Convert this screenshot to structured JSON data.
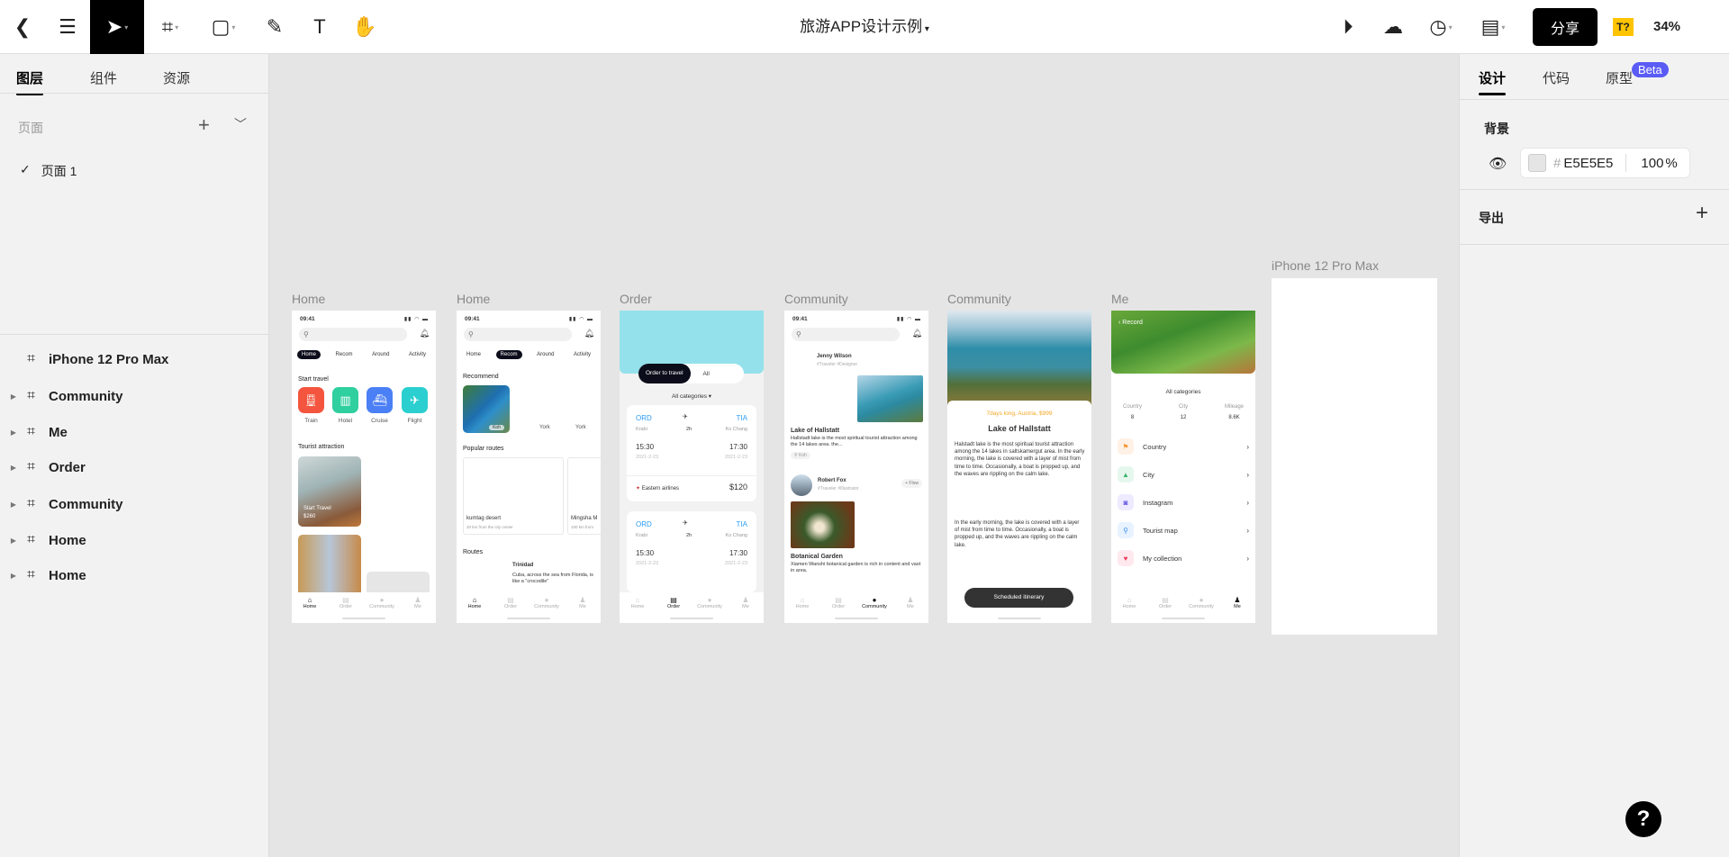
{
  "toolbar": {
    "title": "旅游APP设计示例",
    "share": "分享",
    "zoom": "34%",
    "font_badge": "T?",
    "icons": [
      "back-icon",
      "menu-icon",
      "move-tool-icon",
      "frame-tool-icon",
      "rectangle-tool-icon",
      "pen-tool-icon",
      "text-tool-icon",
      "hand-tool-icon",
      "play-icon",
      "upload-icon",
      "history-icon",
      "layout-icon"
    ]
  },
  "left": {
    "tabs": [
      "图层",
      "组件",
      "资源"
    ],
    "pages_label": "页面",
    "pages": [
      {
        "name": "页面 1",
        "selected": true
      }
    ],
    "layers": [
      "iPhone 12 Pro Max",
      "Community",
      "Me",
      "Order",
      "Community",
      "Home",
      "Home"
    ]
  },
  "right": {
    "tabs": [
      "设计",
      "代码",
      "原型"
    ],
    "beta": "Beta",
    "background_label": "背景",
    "bg_hash": "#",
    "bg_color": "E5E5E5",
    "bg_opacity": "100",
    "pct": "%",
    "export_label": "导出"
  },
  "colors": {
    "accent": "#5b5bf6",
    "canvas": "#E5E5E5",
    "order_header": "#94e1ec"
  },
  "frames": {
    "labels": [
      "Home",
      "Home",
      "Order",
      "Community",
      "Community",
      "Me",
      "iPhone 12 Pro Max"
    ],
    "time": "09:41",
    "tabs": [
      "Home",
      "Recom",
      "Around",
      "Activity"
    ],
    "nav": [
      "Home",
      "Order",
      "Community",
      "Me"
    ],
    "home": {
      "start_travel": "Start travel",
      "services": [
        "Train",
        "Hotel",
        "Cruise",
        "Flight"
      ],
      "tourist": "Tourist attraction",
      "card_title": "Start Travel",
      "card_price": "$260"
    },
    "home2": {
      "recommend": "Recommend",
      "rec_tag": "Koh",
      "rec_items": [
        "York",
        "York"
      ],
      "popular": "Popular routes",
      "routes": [
        {
          "name": "kumtag desert",
          "desc": "20 km from the city center"
        },
        {
          "name": "Mingsha M",
          "desc": "100 km from"
        }
      ],
      "routes_label": "Routes",
      "trip_title": "Trinidad",
      "trip_desc": "Cuba, across the sea from Florida, is like a \"crocodile\""
    },
    "order": {
      "seg": [
        "Order to travel",
        "All"
      ],
      "categories": "All categories ▾",
      "ticket": {
        "from": "ORD",
        "to": "TIA",
        "from_city": "Krabi",
        "duration": "2h",
        "to_city": "Ko Chang",
        "dep": "15:30",
        "arr": "17:30",
        "date": "2021-2-23",
        "airline": "Eastern airlines",
        "price": "$120"
      }
    },
    "community": {
      "user1": "Jenny Wilson",
      "tags1": "#Traveler  #Designer",
      "post1_title": "Lake of Hallstatt",
      "post1_desc": "Hallstadt lake is the most spiritual tourist attraction among the 14 lakes  area. the...",
      "loc": "Koh",
      "user2": "Robert Fox",
      "tags2": "#Traveler #Illustrator",
      "follow": "+ Flow",
      "post2_title": "Botanical Garden",
      "post2_desc": "Xiamen Wanshi botanical garden is rich in content and vast in area."
    },
    "detail": {
      "meta": "7days long, Austria, $999",
      "title": "Lake of Hallstatt",
      "p1": "Halstadt lake is the most spiritual tourist attraction among the 14 lakes in saltskamergut area. In the early morning, the lake is covered with a layer of mist from time to time. Occasionally, a boat is propped up, and the waves are rippling on the calm lake.",
      "p2": "In the early morning, the lake is covered with a layer of mist from time to time. Occasionally, a boat is propped up, and the waves are rippling on the calm lake.",
      "button": "Scheduled itinerary"
    },
    "me": {
      "back": "‹ Record",
      "categories": "All categories",
      "stats": [
        {
          "label": "Country",
          "value": "8"
        },
        {
          "label": "City",
          "value": "12"
        },
        {
          "label": "Mileage",
          "value": "8.6K"
        }
      ],
      "menu": [
        "Country",
        "City",
        "Instagram",
        "Tourist map",
        "My collection"
      ]
    }
  },
  "help": "?"
}
